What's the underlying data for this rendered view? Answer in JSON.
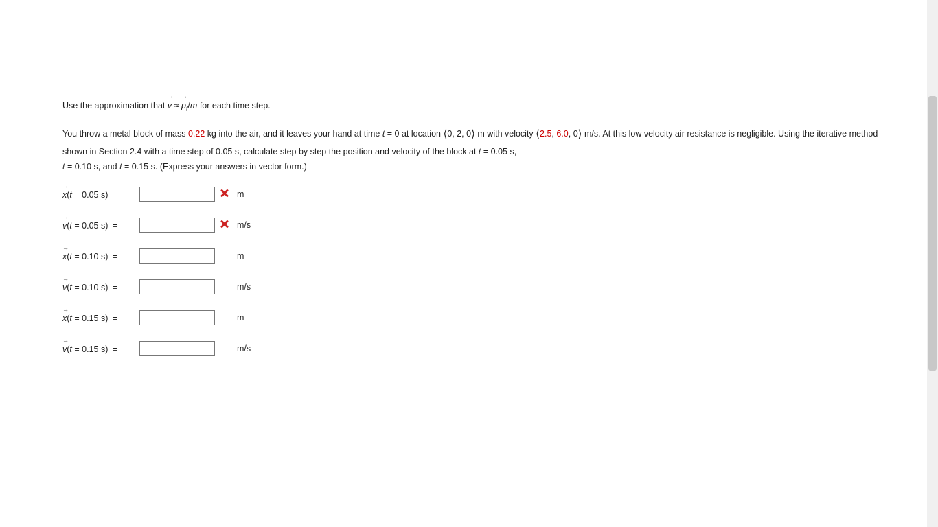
{
  "intro": {
    "pre": "Use the approximation that ",
    "approx": " ≈ ",
    "post": " for each time step."
  },
  "problem": {
    "p1a": "You throw a metal block of mass ",
    "mass": "0.22",
    "p1b": " kg into the air, and it leaves your hand at time ",
    "t0": " = 0",
    "p1c": " at location ",
    "loc": "0, 2, 0",
    "p1d": " m  with velocity ",
    "vel_a": "2.5",
    "vel_b": "6.0",
    "vel_c": "0",
    "p1e": " m/s.  At this low velocity air resistance is negligible. Using the iterative method shown in Section 2.4 with a time step of 0.05 s, calculate step by step the position and velocity of the block at ",
    "t1": " = 0.05 s,",
    "t2": " = 0.10 s,  and ",
    "t3": " = 0.15 s.",
    "express": "  (Express your answers in vector form.)"
  },
  "rows": [
    {
      "sym": "x",
      "t": "0.05",
      "unit": "m",
      "wrong": true
    },
    {
      "sym": "v",
      "t": "0.05",
      "unit": "m/s",
      "wrong": true
    },
    {
      "sym": "x",
      "t": "0.10",
      "unit": "m",
      "wrong": false
    },
    {
      "sym": "v",
      "t": "0.10",
      "unit": "m/s",
      "wrong": false
    },
    {
      "sym": "x",
      "t": "0.15",
      "unit": "m",
      "wrong": false
    },
    {
      "sym": "v",
      "t": "0.15",
      "unit": "m/s",
      "wrong": false
    }
  ],
  "glyphs": {
    "langle": "⟨",
    "rangle": "⟩",
    "comma": ", "
  },
  "vars": {
    "v": "v",
    "p": "p",
    "f": "f",
    "m": "m",
    "t": "t",
    "x": "x"
  }
}
